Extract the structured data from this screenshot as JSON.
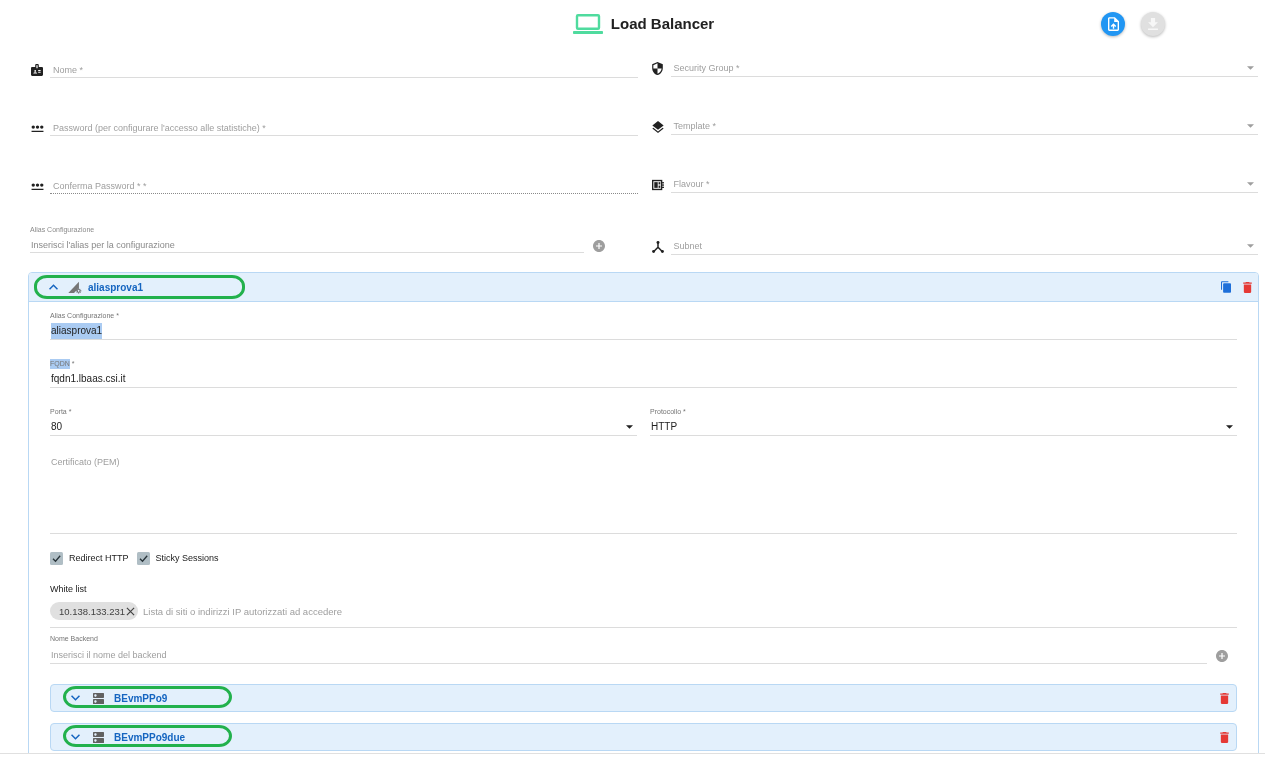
{
  "header": {
    "title": "Load Balancer",
    "actions": [
      {
        "kind": "upload",
        "disabled": false
      },
      {
        "kind": "download",
        "disabled": true
      }
    ]
  },
  "general": {
    "left_fields": [
      {
        "kind": "text",
        "label": "Nome *",
        "disabled": false
      },
      {
        "kind": "password",
        "label": "Password (per configurare l'accesso alle statistiche) *",
        "disabled": false
      },
      {
        "kind": "password",
        "label": "Conferma Password * *",
        "disabled": true
      },
      {
        "kind": "alias",
        "label": "Alias Configurazione",
        "placeholder": "Inserisci l'alias per la configurazione"
      }
    ],
    "right_fields": [
      {
        "kind": "select",
        "label": "Security Group *"
      },
      {
        "kind": "select",
        "label": "Template *"
      },
      {
        "kind": "select",
        "label": "Flavour *"
      },
      {
        "kind": "select",
        "label": "Subnet"
      }
    ]
  },
  "alias_panel": {
    "title": "aliasprova1",
    "expanded": true,
    "highlighted": true,
    "alias": {
      "label": "Alias Configurazione *",
      "value": "aliasprova1",
      "value_selected": true
    },
    "fqdn": {
      "label_parts": [
        {
          "text": "FQDN",
          "selected": true
        },
        {
          "text": "*",
          "selected": false
        }
      ],
      "value": "fqdn1.lbaas.csi.it"
    },
    "port": {
      "label": "Porta *",
      "value": "80"
    },
    "protocol": {
      "label": "Protocollo *",
      "value": "HTTP"
    },
    "certificate": {
      "placeholder": "Certificato (PEM)"
    },
    "options": [
      {
        "label": "Redirect HTTP",
        "checked": true
      },
      {
        "label": "Sticky Sessions",
        "checked": true
      }
    ],
    "whitelist": {
      "label": "White list",
      "chips": [
        {
          "text": "10.138.133.231"
        }
      ],
      "placeholder": "Lista di siti o indirizzi IP autorizzati ad accedere"
    },
    "backend_name": {
      "label": "Nome Backend",
      "placeholder": "Inserisci il nome del backend"
    },
    "backends": [
      {
        "title": "BEvmPPo9",
        "expanded": false,
        "highlighted": true
      },
      {
        "title": "BEvmPPo9due",
        "expanded": false,
        "highlighted": true
      }
    ]
  }
}
